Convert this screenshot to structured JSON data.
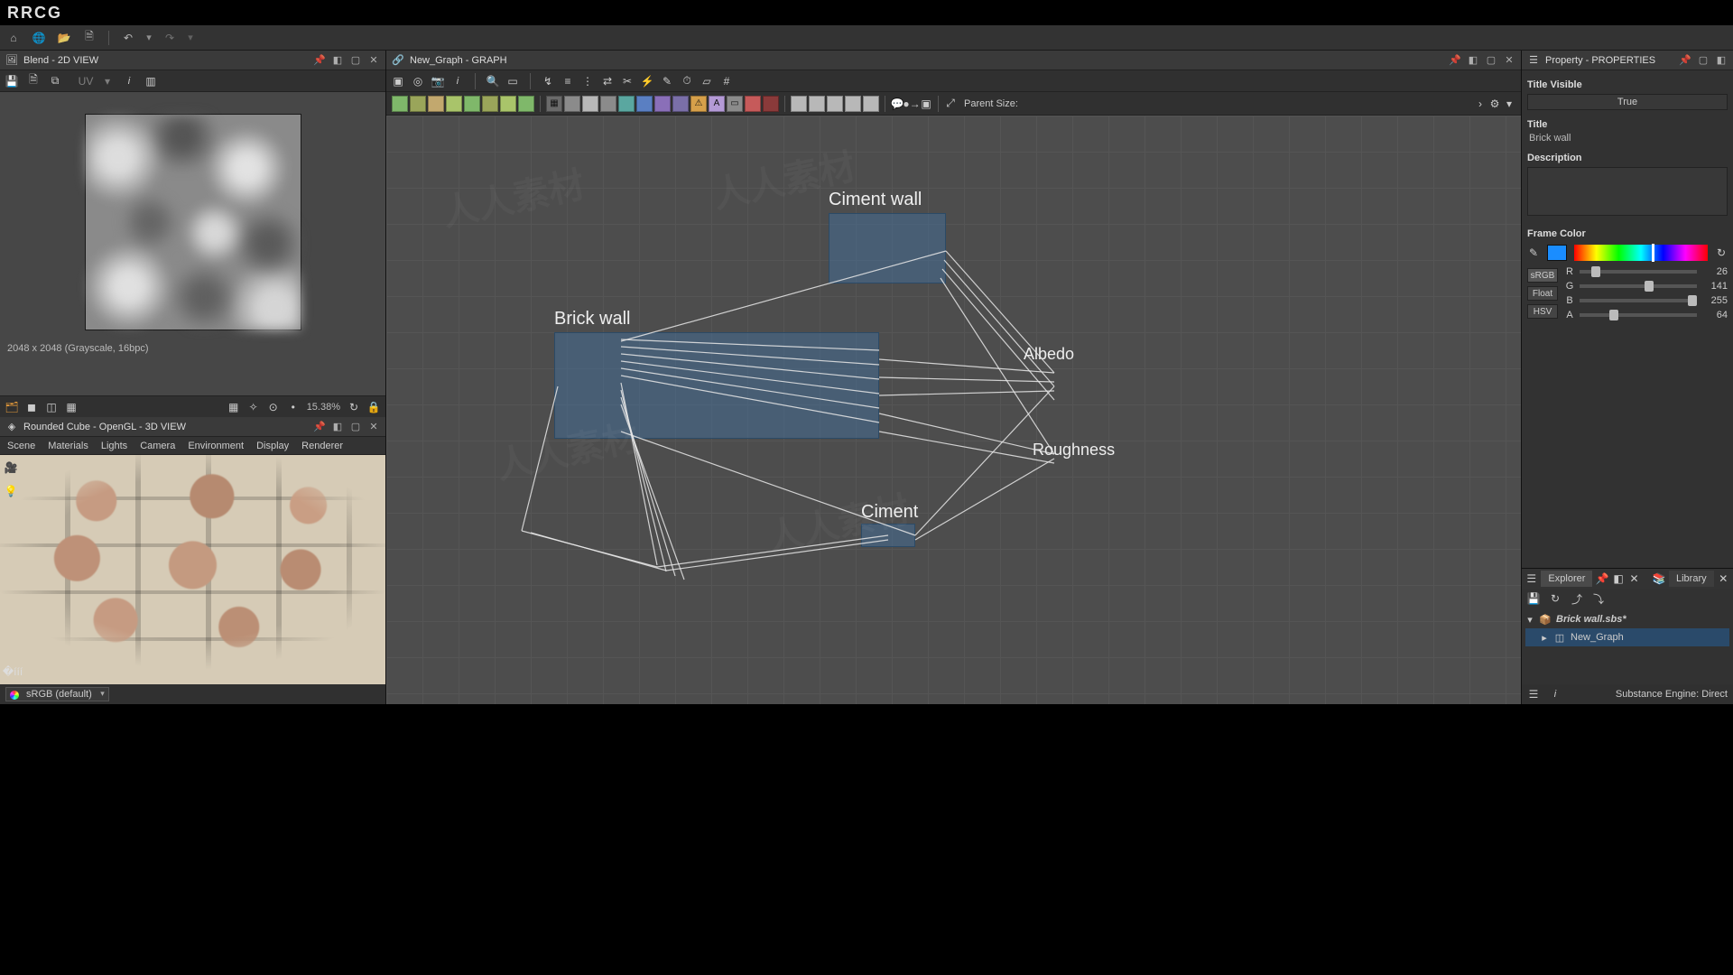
{
  "brand": "RRCG",
  "panels": {
    "view2d": {
      "title": "Blend - 2D VIEW",
      "status": "2048 x 2048 (Grayscale, 16bpc)",
      "zoom": "15.38%"
    },
    "view3d": {
      "title": "Rounded Cube - OpenGL - 3D VIEW",
      "menus": [
        "Scene",
        "Materials",
        "Lights",
        "Camera",
        "Environment",
        "Display",
        "Renderer"
      ],
      "srgb": "sRGB (default)"
    },
    "graph": {
      "title": "New_Graph - GRAPH",
      "parent_size_label": "Parent Size:",
      "frames": {
        "ciment_wall": "Ciment wall",
        "brick_wall": "Brick wall",
        "ciment": "Ciment"
      },
      "outputs": {
        "albedo": "Albedo",
        "roughness": "Roughness"
      }
    },
    "properties": {
      "title": "Property - PROPERTIES",
      "title_visible_label": "Title Visible",
      "title_visible_value": "True",
      "title_label": "Title",
      "title_value": "Brick wall",
      "description_label": "Description",
      "frame_color_label": "Frame Color",
      "modes": {
        "srgb": "sRGB",
        "float": "Float",
        "hsv": "HSV"
      },
      "channels": {
        "R": {
          "label": "R",
          "value": "26",
          "pct": 10
        },
        "G": {
          "label": "G",
          "value": "141",
          "pct": 55
        },
        "B": {
          "label": "B",
          "value": "255",
          "pct": 100
        },
        "A": {
          "label": "A",
          "value": "64",
          "pct": 25
        }
      },
      "swatch_hex": "#1a8dff"
    },
    "explorer": {
      "tab_explorer": "Explorer",
      "tab_library": "Library",
      "file": "Brick wall.sbs*",
      "graph": "New_Graph",
      "engine_status": "Substance Engine: Direct"
    }
  }
}
